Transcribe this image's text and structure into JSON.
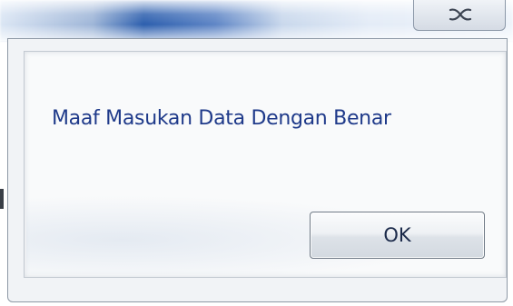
{
  "dialog": {
    "message": "Maaf Masukan Data Dengan Benar",
    "ok_label": "OK"
  },
  "titlebar": {
    "close_icon": "close-icon"
  },
  "colors": {
    "message_text": "#1f3a8a",
    "titlebar_accent": "#2d5fae",
    "button_text": "#1b2a4a"
  }
}
